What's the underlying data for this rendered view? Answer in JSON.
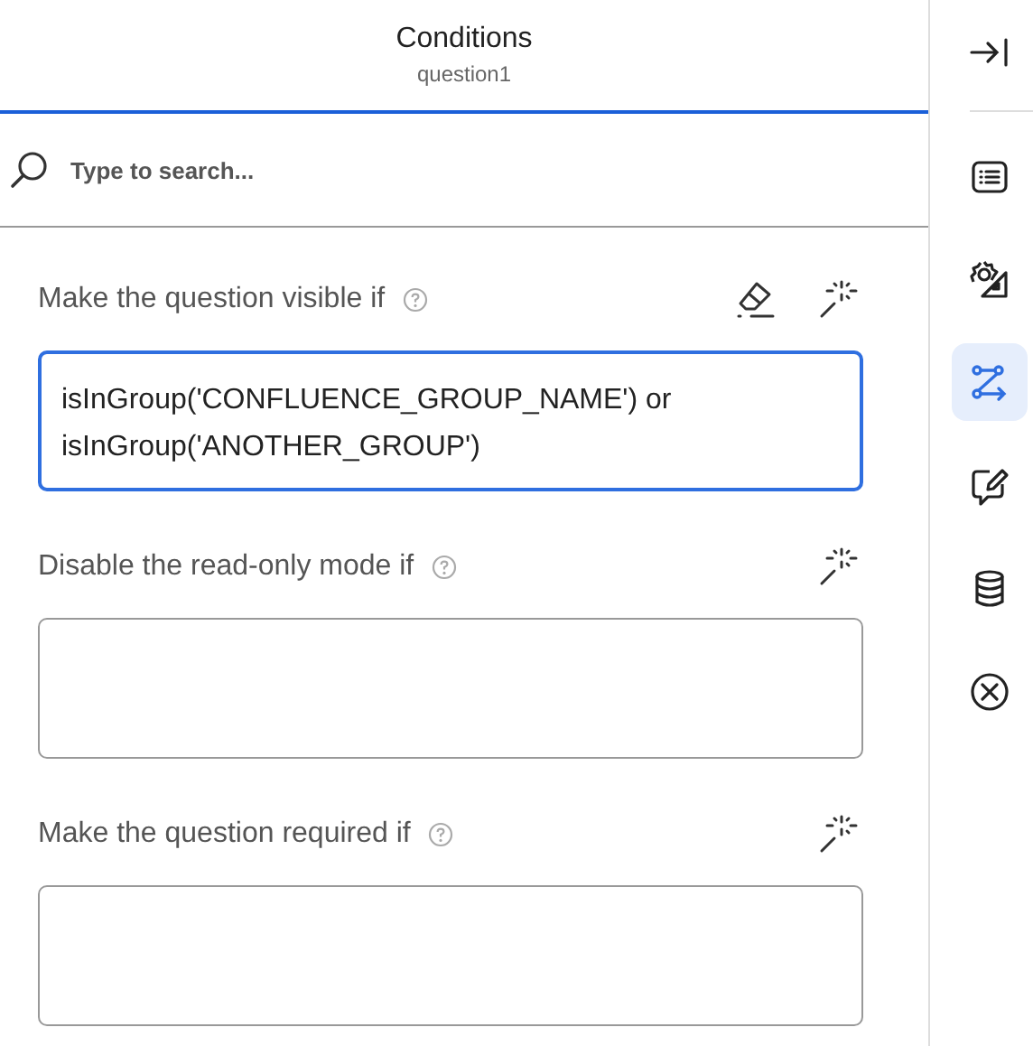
{
  "header": {
    "title": "Conditions",
    "subtitle": "question1"
  },
  "search": {
    "placeholder": "Type to search..."
  },
  "conditions": [
    {
      "label": "Make the question visible if",
      "value": "isInGroup('CONFLUENCE_GROUP_NAME') or isInGroup('ANOTHER_GROUP')",
      "focused": true,
      "clearable": true
    },
    {
      "label": "Disable the read-only mode if",
      "focused": false,
      "clearable": false
    },
    {
      "label": "Make the question required if",
      "focused": false,
      "clearable": false
    }
  ],
  "sidebar": {
    "items": [
      {
        "kind": "list",
        "selected": false
      },
      {
        "kind": "settings",
        "selected": false
      },
      {
        "kind": "logic",
        "selected": true
      },
      {
        "kind": "comment",
        "selected": false
      },
      {
        "kind": "data",
        "selected": false
      },
      {
        "kind": "close",
        "selected": false
      }
    ]
  }
}
